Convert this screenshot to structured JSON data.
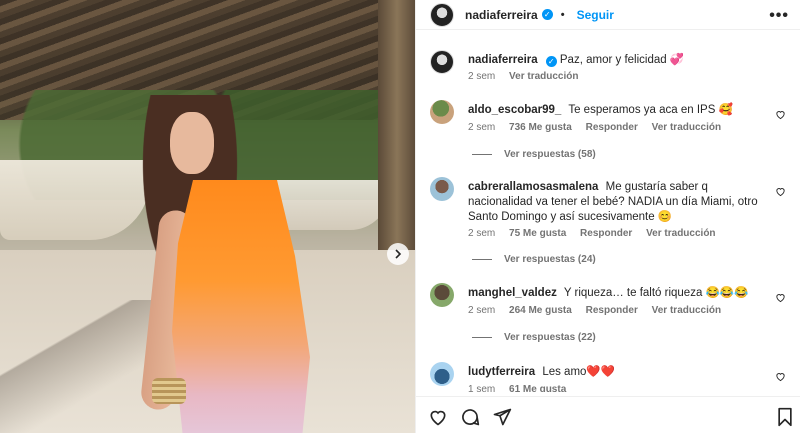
{
  "post": {
    "username": "nadiaferreira",
    "follow_label": "Seguir",
    "more_label": "•••",
    "caption": "Paz, amor y felicidad 💞",
    "caption_time": "2 sem",
    "see_translation": "Ver traducción"
  },
  "comments": [
    {
      "username": "aldo_escobar99_",
      "text": "Te esperamos ya aca en IPS 🥰",
      "time": "2 sem",
      "likes": "736 Me gusta",
      "reply": "Responder",
      "translate": "Ver traducción",
      "replies": "Ver respuestas (58)"
    },
    {
      "username": "cabrerallamosasmalena",
      "text": "Me gustaría saber q nacionalidad va tener el bebé? NADIA un día Miami, otro Santo Domingo y así sucesivamente 😊",
      "time": "2 sem",
      "likes": "75 Me gusta",
      "reply": "Responder",
      "translate": "Ver traducción",
      "replies": "Ver respuestas (24)"
    },
    {
      "username": "manghel_valdez",
      "text": "Y riqueza… te faltó riqueza 😂😂😂",
      "time": "2 sem",
      "likes": "264 Me gusta",
      "reply": "Responder",
      "translate": "Ver traducción",
      "replies": "Ver respuestas (22)"
    },
    {
      "username": "ludytferreira",
      "text": "Les amo❤️❤️",
      "time": "1 sem",
      "likes": "61 Me gusta"
    }
  ],
  "icons": {
    "next": "chevron-right-icon",
    "like": "heart-icon",
    "comment": "comment-icon",
    "share": "send-icon",
    "save": "bookmark-icon"
  },
  "colors": {
    "accent": "#0095f6",
    "muted": "#737373",
    "text": "#262626"
  }
}
